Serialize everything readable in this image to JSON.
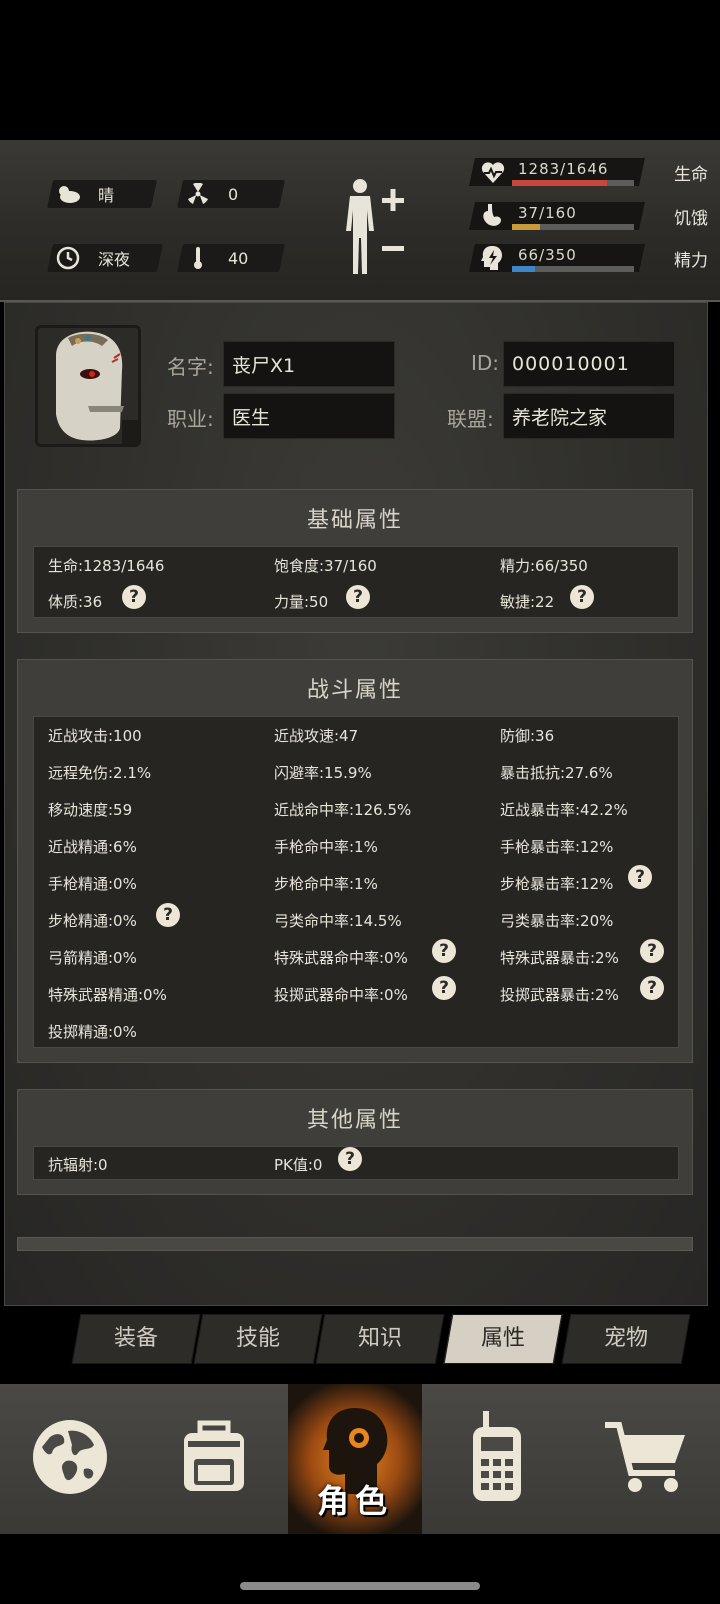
{
  "status": {
    "weather": "晴",
    "radiation": "0",
    "time_of_day": "深夜",
    "temperature": "40",
    "vitals": [
      {
        "name": "health",
        "value_text": "1283/1646",
        "label": "生命",
        "fraction": 0.7795,
        "color": "#c8463a"
      },
      {
        "name": "hunger",
        "value_text": "37/160",
        "label": "饥饿",
        "fraction": 0.23,
        "color": "#c89a3a"
      },
      {
        "name": "energy",
        "value_text": "66/350",
        "label": "精力",
        "fraction": 0.19,
        "color": "#3f86c8"
      }
    ]
  },
  "profile": {
    "name_label": "名字:",
    "name_value": "丧尸X1",
    "id_label": "ID:",
    "id_value": "000010001",
    "job_label": "职业:",
    "job_value": "医生",
    "alliance_label": "联盟:",
    "alliance_value": "养老院之家"
  },
  "basic": {
    "title": "基础属性",
    "rows": [
      [
        "生命:1283/1646",
        "饱食度:37/160",
        "精力:66/350"
      ],
      [
        "体质:36",
        "力量:50",
        "敏捷:22"
      ]
    ]
  },
  "combat": {
    "title": "战斗属性",
    "rows": [
      [
        "近战攻击:100",
        "近战攻速:47",
        "防御:36"
      ],
      [
        "远程免伤:2.1%",
        "闪避率:15.9%",
        "暴击抵抗:27.6%"
      ],
      [
        "移动速度:59",
        "近战命中率:126.5%",
        "近战暴击率:42.2%"
      ],
      [
        "近战精通:6%",
        "手枪命中率:1%",
        "手枪暴击率:12%"
      ],
      [
        "手枪精通:0%",
        "步枪命中率:1%",
        "步枪暴击率:12%"
      ],
      [
        "步枪精通:0%",
        "弓类命中率:14.5%",
        "弓类暴击率:20%"
      ],
      [
        "弓箭精通:0%",
        "特殊武器命中率:0%",
        "特殊武器暴击:2%"
      ],
      [
        "特殊武器精通:0%",
        "投掷武器命中率:0%",
        "投掷武器暴击:2%"
      ],
      [
        "投掷精通:0%",
        "",
        ""
      ]
    ]
  },
  "other": {
    "title": "其他属性",
    "rows": [
      [
        "抗辐射:0",
        "PK值:0"
      ]
    ]
  },
  "help_mark": "?",
  "tabs": [
    "装备",
    "技能",
    "知识",
    "属性",
    "宠物"
  ],
  "active_tab": "属性",
  "bottom_nav": {
    "active_label": "角色",
    "items": [
      "world-icon",
      "backpack-icon",
      "character-icon",
      "radio-icon",
      "cart-icon"
    ]
  }
}
